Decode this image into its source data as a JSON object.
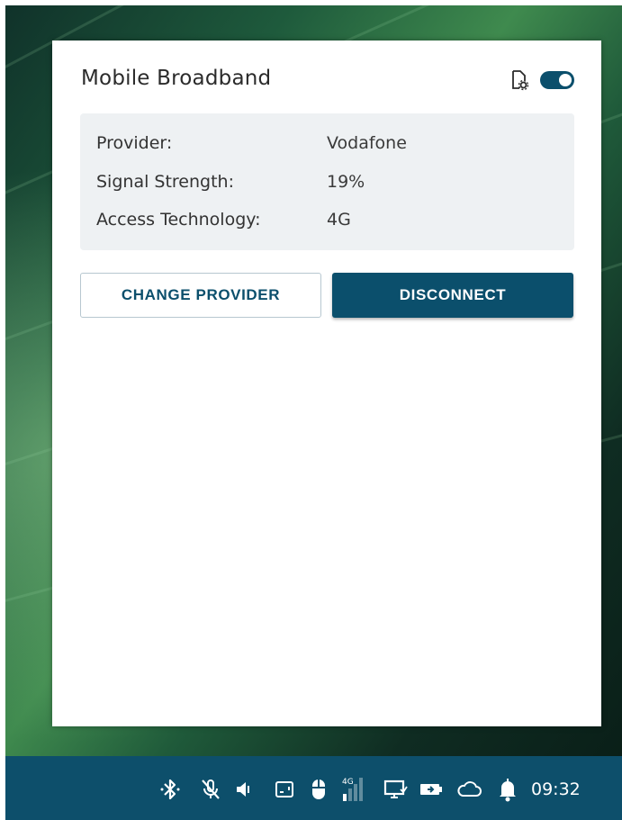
{
  "panel": {
    "title": "Mobile Broadband",
    "enabled": true
  },
  "info": {
    "rows": [
      {
        "label": "Provider:",
        "value": "Vodafone"
      },
      {
        "label": "Signal Strength:",
        "value": "19%"
      },
      {
        "label": "Access Technology:",
        "value": "4G"
      }
    ]
  },
  "buttons": {
    "change_provider": "CHANGE PROVIDER",
    "disconnect": "DISCONNECT"
  },
  "taskbar": {
    "icons": [
      "bluetooth-icon",
      "microphone-muted-icon",
      "volume-icon",
      "screenshot-icon",
      "mouse-icon",
      "mobile-signal-4g-icon",
      "display-icon",
      "battery-icon",
      "cloud-icon",
      "notification-bell-icon"
    ],
    "network_type": "4G",
    "clock": "09:32"
  },
  "colors": {
    "accent": "#0b4f6c",
    "info_background": "#eef1f3",
    "taskbar": "#0d4f6b"
  }
}
